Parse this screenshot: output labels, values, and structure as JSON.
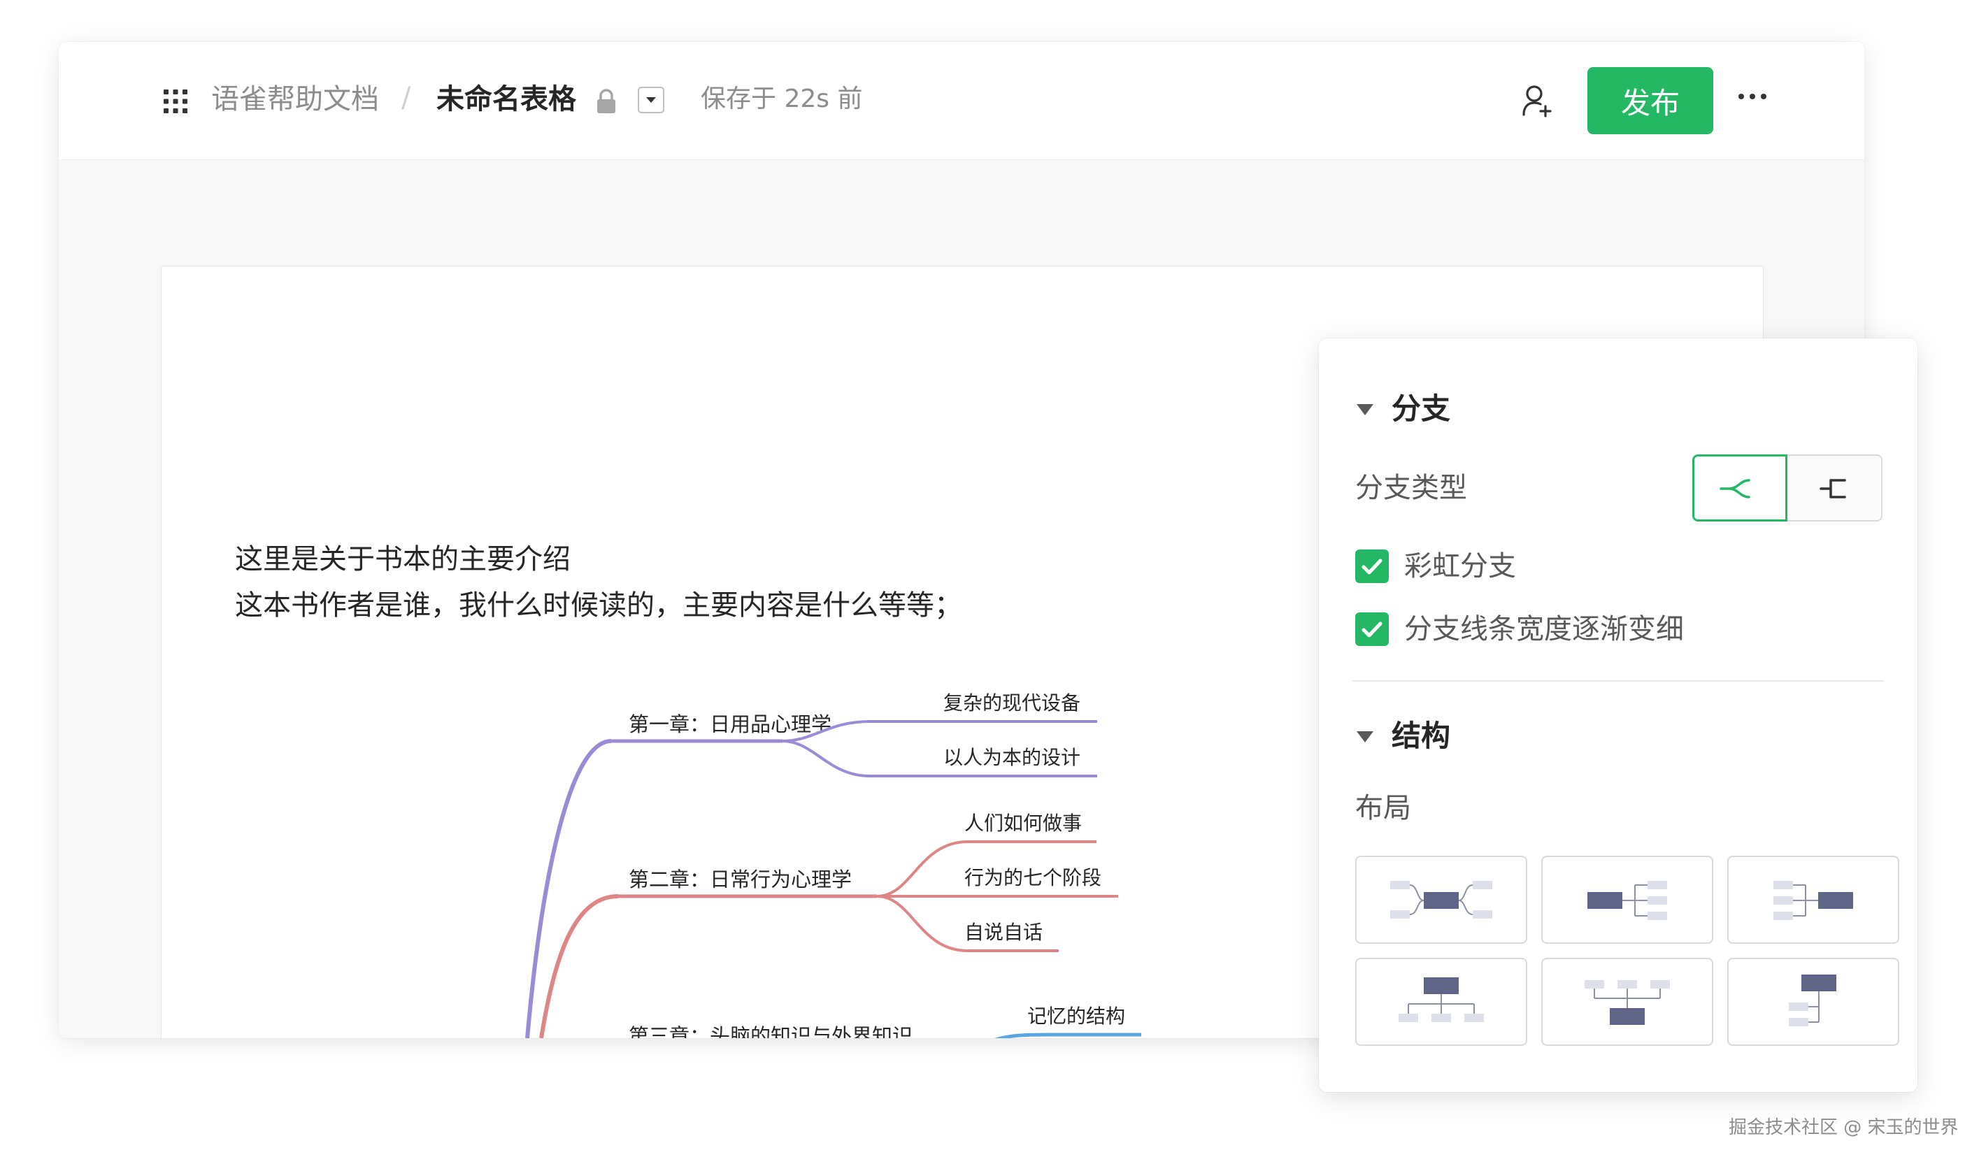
{
  "header": {
    "breadcrumb_parent": "语雀帮助文档",
    "breadcrumb_separator": "/",
    "doc_title": "未命名表格",
    "save_status": "保存于 22s 前",
    "publish_label": "发布"
  },
  "canvas": {
    "intro_line_1": "这里是关于书本的主要介绍",
    "intro_line_2": "这本书作者是谁，我什么时候读的，主要内容是什么等等；"
  },
  "mindmap": {
    "chapters": [
      {
        "label": "第一章：日用品心理学",
        "color": "#9b8bd6",
        "children": [
          "复杂的现代设备",
          "以人为本的设计"
        ]
      },
      {
        "label": "第二章：日常行为心理学",
        "color": "#de8585",
        "children": [
          "人们如何做事",
          "行为的七个阶段",
          "自说自话"
        ]
      },
      {
        "label": "第三章：头脑的知识与外界知识",
        "color": "#5aa6e0",
        "children": [
          "记忆的结构"
        ]
      }
    ]
  },
  "panel": {
    "branch_section_title": "分支",
    "branch_type_label": "分支类型",
    "rainbow_branch_label": "彩虹分支",
    "rainbow_branch_checked": true,
    "taper_label": "分支线条宽度逐渐变细",
    "taper_checked": true,
    "structure_section_title": "结构",
    "layout_label": "布局",
    "accent_color": "#25b864"
  },
  "watermark": "掘金技术社区 @ 宋玉的世界"
}
